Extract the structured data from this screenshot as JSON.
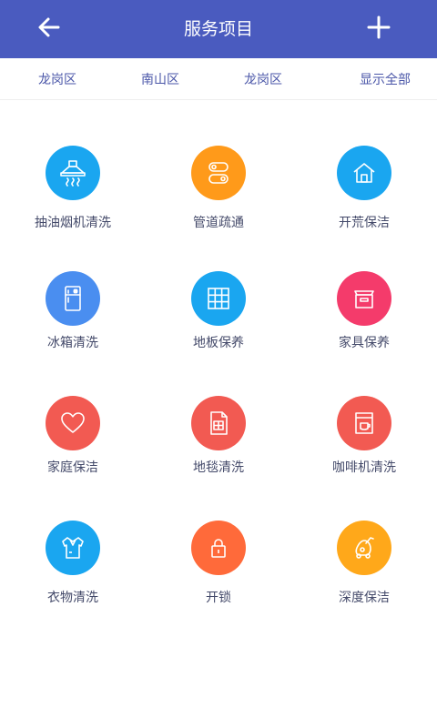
{
  "header": {
    "title": "服务项目",
    "back_icon": "arrow-left-icon",
    "add_icon": "plus-icon",
    "bg_color": "#4a5bbf"
  },
  "districts": [
    {
      "label": "龙岗区"
    },
    {
      "label": "南山区"
    },
    {
      "label": "龙岗区"
    },
    {
      "label": "显示全部"
    }
  ],
  "services": [
    {
      "label": "抽油烟机清洗",
      "icon": "range-hood-icon",
      "color": "#1aa6f0"
    },
    {
      "label": "管道疏通",
      "icon": "pipe-icon",
      "color": "#ff9a1a"
    },
    {
      "label": "开荒保洁",
      "icon": "house-icon",
      "color": "#1aa6f0"
    },
    {
      "label": "冰箱清洗",
      "icon": "fridge-icon",
      "color": "#4a8ef0"
    },
    {
      "label": "地板保养",
      "icon": "floor-tiles-icon",
      "color": "#1aa6f0"
    },
    {
      "label": "家具保养",
      "icon": "cabinet-icon",
      "color": "#f43b6b"
    },
    {
      "label": "家庭保洁",
      "icon": "heart-icon",
      "color": "#f25a52"
    },
    {
      "label": "地毯清洗",
      "icon": "carpet-icon",
      "color": "#f25a52"
    },
    {
      "label": "咖啡机清洗",
      "icon": "coffee-machine-icon",
      "color": "#f25a52"
    },
    {
      "label": "衣物清洗",
      "icon": "shirt-icon",
      "color": "#1aa6f0"
    },
    {
      "label": "开锁",
      "icon": "lock-icon",
      "color": "#ff6a3a"
    },
    {
      "label": "深度保洁",
      "icon": "vacuum-icon",
      "color": "#ffa81a"
    }
  ]
}
